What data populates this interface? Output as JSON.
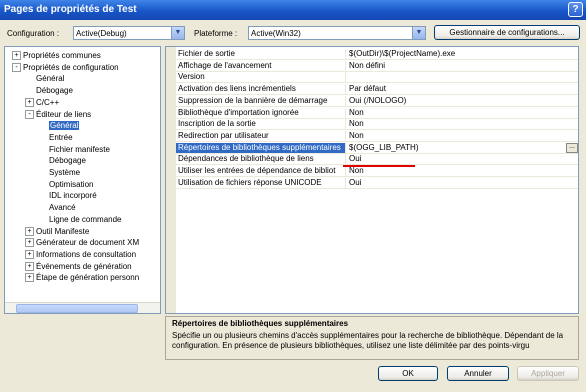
{
  "window": {
    "title": "Pages de propriétés de Test",
    "help_glyph": "?"
  },
  "toolbar": {
    "config_label": "Configuration :",
    "config_value": "Active(Debug)",
    "platform_label": "Plateforme :",
    "platform_value": "Active(Win32)",
    "config_manager_button": "Gestionnaire de configurations..."
  },
  "tree": {
    "items": [
      {
        "label": "Propriétés communes",
        "indent": 0,
        "expander": "+"
      },
      {
        "label": "Propriétés de configuration",
        "indent": 0,
        "expander": "-"
      },
      {
        "label": "Général",
        "indent": 1,
        "expander": ""
      },
      {
        "label": "Débogage",
        "indent": 1,
        "expander": ""
      },
      {
        "label": "C/C++",
        "indent": 1,
        "expander": "+"
      },
      {
        "label": "Éditeur de liens",
        "indent": 1,
        "expander": "-"
      },
      {
        "label": "Général",
        "indent": 2,
        "expander": "",
        "selected": true
      },
      {
        "label": "Entrée",
        "indent": 2,
        "expander": ""
      },
      {
        "label": "Fichier manifeste",
        "indent": 2,
        "expander": ""
      },
      {
        "label": "Débogage",
        "indent": 2,
        "expander": ""
      },
      {
        "label": "Système",
        "indent": 2,
        "expander": ""
      },
      {
        "label": "Optimisation",
        "indent": 2,
        "expander": ""
      },
      {
        "label": "IDL incorporé",
        "indent": 2,
        "expander": ""
      },
      {
        "label": "Avancé",
        "indent": 2,
        "expander": ""
      },
      {
        "label": "Ligne de commande",
        "indent": 2,
        "expander": ""
      },
      {
        "label": "Outil Manifeste",
        "indent": 1,
        "expander": "+"
      },
      {
        "label": "Générateur de document XM",
        "indent": 1,
        "expander": "+"
      },
      {
        "label": "Informations de consultation",
        "indent": 1,
        "expander": "+"
      },
      {
        "label": "Événements de génération",
        "indent": 1,
        "expander": "+"
      },
      {
        "label": "Étape de génération personn",
        "indent": 1,
        "expander": "+"
      }
    ]
  },
  "grid": {
    "rows": [
      {
        "name": "Fichier de sortie",
        "value": "$(OutDir)\\$(ProjectName).exe"
      },
      {
        "name": "Affichage de l'avancement",
        "value": "Non défini"
      },
      {
        "name": "Version",
        "value": ""
      },
      {
        "name": "Activation des liens incrémentiels",
        "value": "Par défaut"
      },
      {
        "name": "Suppression de la bannière de démarrage",
        "value": "Oui (/NOLOGO)"
      },
      {
        "name": "Bibliothèque d'importation ignorée",
        "value": "Non"
      },
      {
        "name": "Inscription de la sortie",
        "value": "Non"
      },
      {
        "name": "Redirection par utilisateur",
        "value": "Non"
      },
      {
        "name": "Répertoires de bibliothèques supplémentaires",
        "value": "$(OGG_LIB_PATH)",
        "selected": true
      },
      {
        "name": "Dépendances de bibliothèque de liens",
        "value": "Oui"
      },
      {
        "name": "Utiliser les entrées de dépendance de bibliot",
        "value": "Non"
      },
      {
        "name": "Utilisation de fichiers réponse UNICODE",
        "value": "Oui"
      }
    ],
    "ellipsis": "..."
  },
  "description": {
    "title": "Répertoires de bibliothèques supplémentaires",
    "text": "Spécifie un ou plusieurs chemins d'accès supplémentaires pour la recherche de bibliothèque. Dépendant de la configuration. En présence de plusieurs bibliothèques, utilisez une liste délimitée par des points-virgu"
  },
  "buttons": {
    "ok": "OK",
    "cancel": "Annuler",
    "apply": "Appliquer"
  },
  "colors": {
    "selection": "#316ac5",
    "annotation_underline": "#e00000"
  }
}
